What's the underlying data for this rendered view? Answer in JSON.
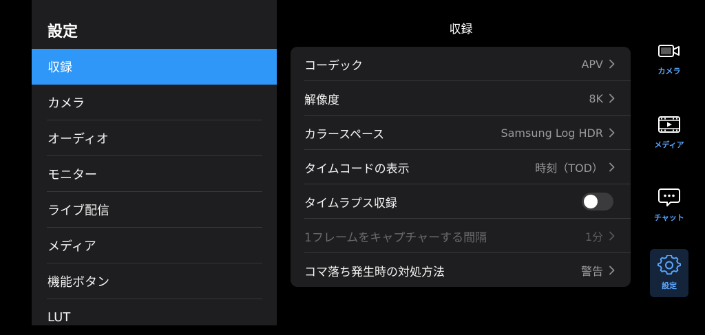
{
  "sidebar": {
    "title": "設定",
    "items": [
      {
        "label": "収録"
      },
      {
        "label": "カメラ"
      },
      {
        "label": "オーディオ"
      },
      {
        "label": "モニター"
      },
      {
        "label": "ライブ配信"
      },
      {
        "label": "メディア"
      },
      {
        "label": "機能ボタン"
      },
      {
        "label": "LUT"
      }
    ]
  },
  "main": {
    "title": "収録",
    "rows": [
      {
        "label": "コーデック",
        "value": "APV"
      },
      {
        "label": "解像度",
        "value": "8K"
      },
      {
        "label": "カラースペース",
        "value": "Samsung Log HDR"
      },
      {
        "label": "タイムコードの表示",
        "value": "時刻（TOD）"
      },
      {
        "label": "タイムラプス収録",
        "toggle": false
      },
      {
        "label": "1フレームをキャプチャーする間隔",
        "value": "1分",
        "disabled": true
      },
      {
        "label": "コマ落ち発生時の対処方法",
        "value": "警告"
      }
    ]
  },
  "nav": {
    "items": [
      {
        "label": "カメラ",
        "icon": "video-camera-icon"
      },
      {
        "label": "メディア",
        "icon": "media-film-icon"
      },
      {
        "label": "チャット",
        "icon": "chat-bubble-icon"
      },
      {
        "label": "設定",
        "icon": "gear-icon"
      }
    ]
  },
  "colors": {
    "accent": "#2f97f7",
    "nav_label": "#5aa7ff",
    "panel": "#1e1e20",
    "background": "#000000"
  }
}
